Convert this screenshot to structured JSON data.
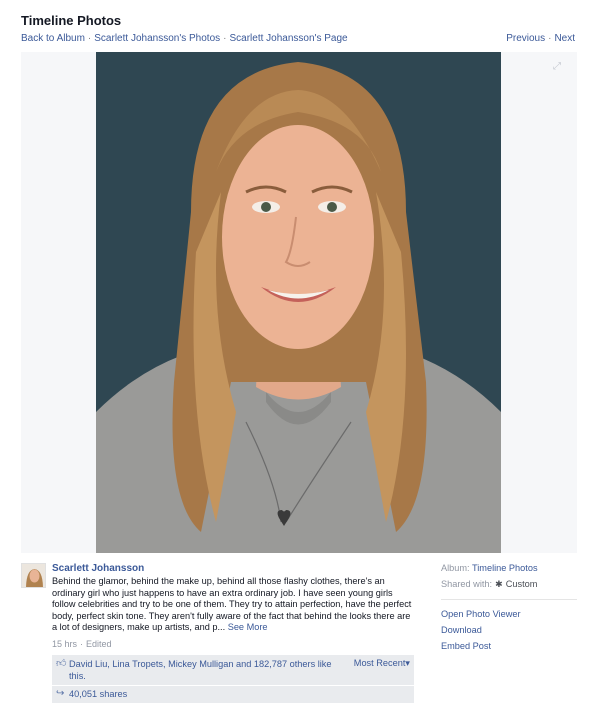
{
  "header": {
    "title": "Timeline Photos",
    "breadcrumb": [
      "Back to Album",
      "Scarlett Johansson's Photos",
      "Scarlett Johansson's Page"
    ],
    "breadcrumb_separator": "·",
    "previous_label": "Previous",
    "next_label": "Next",
    "pager_separator": "·"
  },
  "photo": {
    "background_color": "#2f4752"
  },
  "post": {
    "author": "Scarlett Johansson",
    "text": "Behind the glamor, behind the make up, behind all those flashy clothes, there's an ordinary girl who just happens to have an extra ordinary job. I have seen young girls follow celebrities and try to be one of them. They try to attain perfection, have the perfect body, perfect skin tone. They aren't fully aware of the fact that behind the looks there are a lot of designers, make up artists, and p...",
    "see_more": "See More",
    "time": "15 hrs",
    "edited": "Edited",
    "meta_separator": "·",
    "likes_text": "David Liu, Lina Tropets, Mickey Mulligan and 182,787 others like this.",
    "most_recent": "Most Recent",
    "most_recent_caret": "▾",
    "shares": "40,051 shares",
    "like_icon": "thumbs-up-icon",
    "share_icon": "share-arrow-icon"
  },
  "sidebar": {
    "album_label": "Album:",
    "album_name": "Timeline Photos",
    "shared_label": "Shared with:",
    "shared_value": "Custom",
    "open_viewer": "Open Photo Viewer",
    "download": "Download",
    "embed": "Embed Post"
  },
  "colors": {
    "link": "#3b5998",
    "muted": "#9197a3",
    "panel": "#e9ebee"
  }
}
